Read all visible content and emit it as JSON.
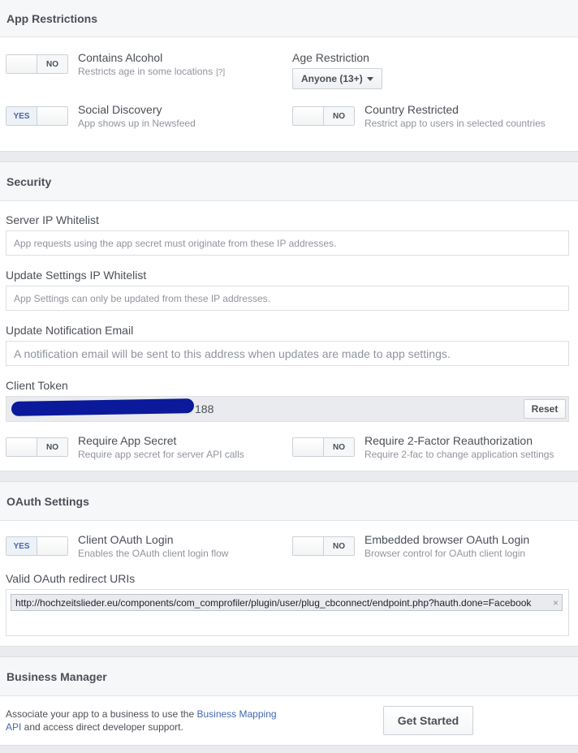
{
  "app_restrictions": {
    "title": "App Restrictions",
    "contains_alcohol": {
      "label": "Contains Alcohol",
      "desc": "Restricts age in some locations",
      "help": "[?]",
      "toggle": "NO"
    },
    "social_discovery": {
      "label": "Social Discovery",
      "desc": "App shows up in Newsfeed",
      "toggle": "YES"
    },
    "age_restriction": {
      "label": "Age Restriction",
      "selected": "Anyone (13+)"
    },
    "country_restricted": {
      "label": "Country Restricted",
      "desc": "Restrict app to users in selected countries",
      "toggle": "NO"
    }
  },
  "security": {
    "title": "Security",
    "server_ip": {
      "label": "Server IP Whitelist",
      "placeholder": "App requests using the app secret must originate from these IP addresses."
    },
    "settings_ip": {
      "label": "Update Settings IP Whitelist",
      "placeholder": "App Settings can only be updated from these IP addresses."
    },
    "notification_email": {
      "label": "Update Notification Email",
      "placeholder": "A notification email will be sent to this address when updates are made to app settings."
    },
    "client_token": {
      "label": "Client Token",
      "visible_suffix": "188",
      "reset_label": "Reset"
    },
    "require_app_secret": {
      "label": "Require App Secret",
      "desc": "Require app secret for server API calls",
      "toggle": "NO"
    },
    "require_2fa": {
      "label": "Require 2-Factor Reauthorization",
      "desc": "Require 2-fac to change application settings",
      "toggle": "NO"
    }
  },
  "oauth": {
    "title": "OAuth Settings",
    "client_login": {
      "label": "Client OAuth Login",
      "desc": "Enables the OAuth client login flow",
      "toggle": "YES"
    },
    "embedded_login": {
      "label": "Embedded browser OAuth Login",
      "desc": "Browser control for OAuth client login",
      "toggle": "NO"
    },
    "redirect_uris": {
      "label": "Valid OAuth redirect URIs",
      "uri": "http://hochzeitslieder.eu/components/com_comprofiler/plugin/user/plug_cbconnect/endpoint.php?hauth.done=Facebook",
      "remove": "×"
    }
  },
  "business": {
    "title": "Business Manager",
    "text_before": "Associate your app to a business to use the ",
    "link": "Business Mapping API",
    "text_after": " and access direct developer support.",
    "button": "Get Started"
  },
  "colors": {
    "accent": "#4267b2",
    "redaction": "#0a1a9a"
  }
}
